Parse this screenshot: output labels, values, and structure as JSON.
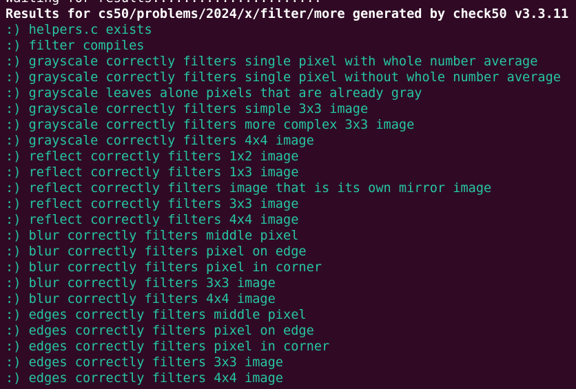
{
  "terminal": {
    "partial_top_line": "Waiting for results......................",
    "header": "Results for cs50/problems/2024/x/filter/more generated by check50 v3.3.11",
    "results": [
      ":) helpers.c exists",
      ":) filter compiles",
      ":) grayscale correctly filters single pixel with whole number average",
      ":) grayscale correctly filters single pixel without whole number average",
      ":) grayscale leaves alone pixels that are already gray",
      ":) grayscale correctly filters simple 3x3 image",
      ":) grayscale correctly filters more complex 3x3 image",
      ":) grayscale correctly filters 4x4 image",
      ":) reflect correctly filters 1x2 image",
      ":) reflect correctly filters 1x3 image",
      ":) reflect correctly filters image that is its own mirror image",
      ":) reflect correctly filters 3x3 image",
      ":) reflect correctly filters 4x4 image",
      ":) blur correctly filters middle pixel",
      ":) blur correctly filters pixel on edge",
      ":) blur correctly filters pixel in corner",
      ":) blur correctly filters 3x3 image",
      ":) blur correctly filters 4x4 image",
      ":) edges correctly filters middle pixel",
      ":) edges correctly filters pixel on edge",
      ":) edges correctly filters pixel in corner",
      ":) edges correctly filters 3x3 image",
      ":) edges correctly filters 4x4 image"
    ],
    "colors": {
      "background": "#300a24",
      "pass": "#26c6a4",
      "text": "#ffffff"
    }
  }
}
